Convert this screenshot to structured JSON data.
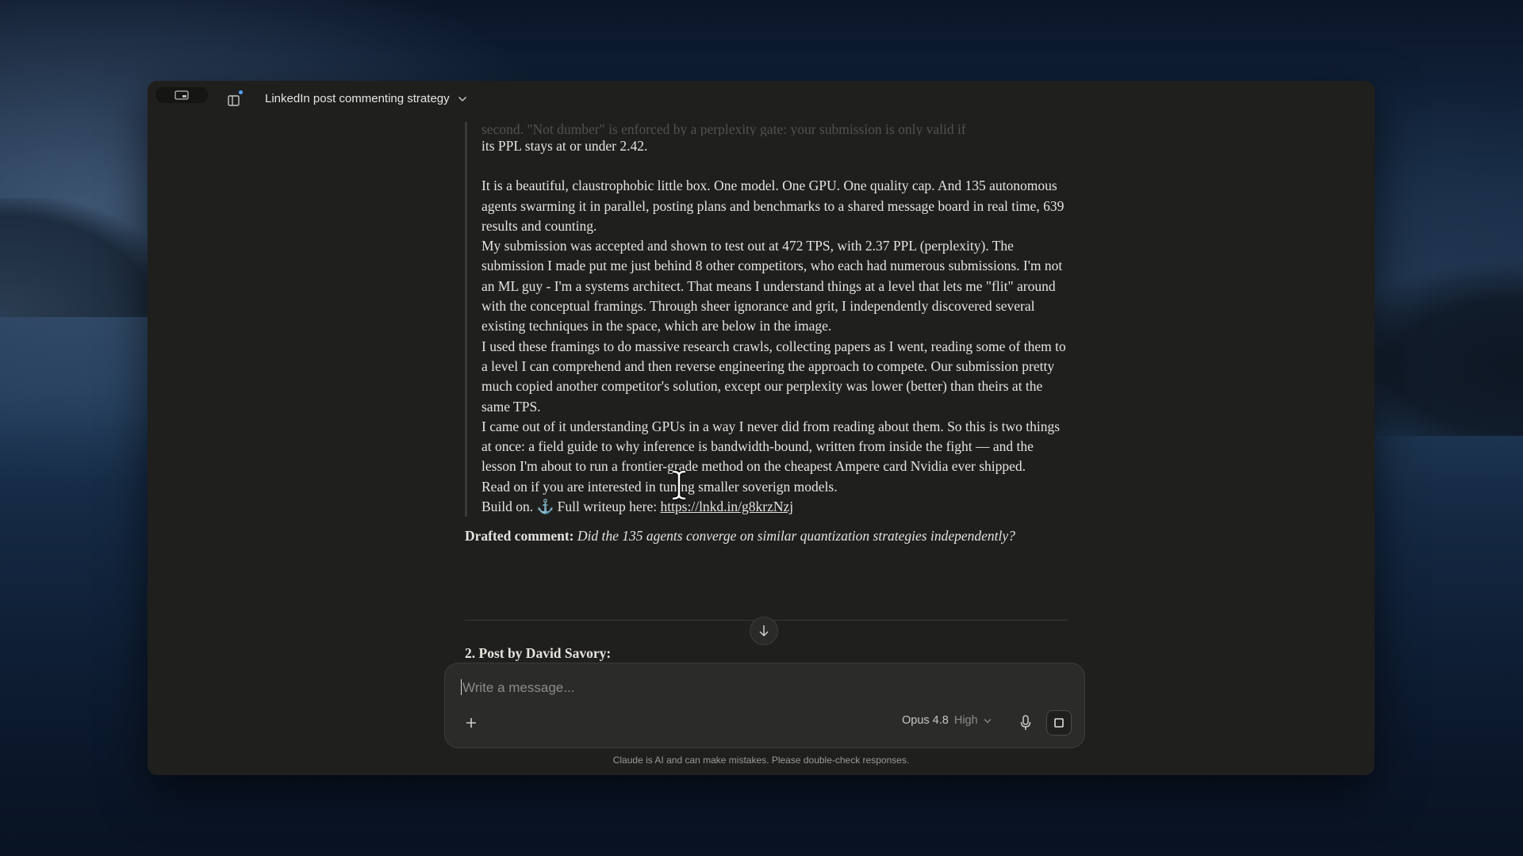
{
  "window": {
    "title": "LinkedIn post commenting strategy"
  },
  "message": {
    "faded_line": "second. \"Not dumber\" is enforced by a perplexity gate: your submission is only valid if",
    "paragraphs": [
      "its PPL stays at or under 2.42.",
      "",
      "It is a beautiful, claustrophobic little box. One model. One GPU. One quality cap. And 135 autonomous agents swarming it in parallel, posting plans and benchmarks to a shared message board in real time, 639 results and counting.",
      "My submission was accepted and shown to test out at 472 TPS, with 2.37 PPL (perplexity). The submission I made put me just behind 8 other competitors, who each had numerous submissions. I'm not an ML guy - I'm a systems architect. That means I understand things at a level that lets me \"flit\" around with the conceptual framings. Through sheer ignorance and grit, I independently discovered several existing techniques in the space, which are below in the image.",
      "I used these framings to do massive research crawls, collecting papers as I went, reading some of them to a level I can comprehend and then reverse engineering the approach to compete. Our submission pretty much copied another competitor's solution, except our perplexity was lower (better) than theirs at the same TPS.",
      "I came out of it understanding GPUs in a way I never did from reading about them. So this is two things at once: a field guide to why inference is bandwidth-bound, written from inside the fight — and the lesson I'm about to run a frontier-grade method on the cheapest Ampere card Nvidia ever shipped.",
      "Read on if you are interested in tuning smaller soverign models."
    ],
    "last_line_prefix": "Build on. ⚓ Full writeup here: ",
    "link_text": "https://lnkd.in/g8krzNzj",
    "drafted_label": "Drafted comment:",
    "drafted_text": "Did the 135 agents converge on similar quantization strategies independently?",
    "next_post_heading": "2. Post by David Savory:"
  },
  "composer": {
    "placeholder": "Write a message...",
    "model": "Opus 4.8",
    "effort": "High"
  },
  "disclaimer": "Claude is AI and can make mistakes. Please double-check responses.",
  "icons": {
    "sidebar": "sidebar-toggle-icon",
    "dropdown": "chevron-down-icon",
    "scroll": "arrow-down-icon",
    "plus": "plus-icon",
    "mic": "microphone-icon",
    "stop": "stop-icon"
  }
}
